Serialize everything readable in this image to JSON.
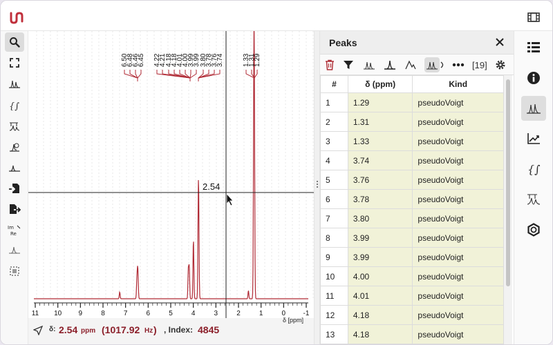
{
  "spectrum": {
    "peak_labels": [
      "6.50",
      "6.48",
      "6.46",
      "6.45",
      "4.22",
      "4.21",
      "4.18",
      "4.18",
      "4.01",
      "4.00",
      "3.99",
      "3.99",
      "3.80",
      "3.78",
      "3.76",
      "3.74",
      "1.33",
      "1.31",
      "1.29"
    ],
    "axis_ticks": [
      "11",
      "10",
      "9",
      "8",
      "7",
      "6",
      "5",
      "4",
      "3",
      "2",
      "1",
      "0",
      "-1"
    ],
    "axis_label": "δ [ppm]",
    "crosshair_value": "2.54"
  },
  "status": {
    "delta_prefix": "δ:",
    "delta_value": "2.54",
    "delta_unit": "ppm",
    "hz_value": "(1017.92",
    "hz_unit": "Hz",
    "hz_close": ")",
    "index_label": ", Index:",
    "index_value": "4845"
  },
  "panel": {
    "title": "Peaks",
    "count": "[19]",
    "columns": [
      "#",
      "δ (ppm)",
      "Kind"
    ],
    "rows": [
      {
        "n": "1",
        "ppm": "1.29",
        "kind": "pseudoVoigt"
      },
      {
        "n": "2",
        "ppm": "1.31",
        "kind": "pseudoVoigt"
      },
      {
        "n": "3",
        "ppm": "1.33",
        "kind": "pseudoVoigt"
      },
      {
        "n": "4",
        "ppm": "3.74",
        "kind": "pseudoVoigt"
      },
      {
        "n": "5",
        "ppm": "3.76",
        "kind": "pseudoVoigt"
      },
      {
        "n": "6",
        "ppm": "3.78",
        "kind": "pseudoVoigt"
      },
      {
        "n": "7",
        "ppm": "3.80",
        "kind": "pseudoVoigt"
      },
      {
        "n": "8",
        "ppm": "3.99",
        "kind": "pseudoVoigt"
      },
      {
        "n": "9",
        "ppm": "3.99",
        "kind": "pseudoVoigt"
      },
      {
        "n": "10",
        "ppm": "4.00",
        "kind": "pseudoVoigt"
      },
      {
        "n": "11",
        "ppm": "4.01",
        "kind": "pseudoVoigt"
      },
      {
        "n": "12",
        "ppm": "4.18",
        "kind": "pseudoVoigt"
      },
      {
        "n": "13",
        "ppm": "4.18",
        "kind": "pseudoVoigt"
      }
    ]
  },
  "colors": {
    "accent": "#8b1f2a",
    "spectrum_line": "#b02a35",
    "table_value_bg": "#f1f2d8"
  }
}
